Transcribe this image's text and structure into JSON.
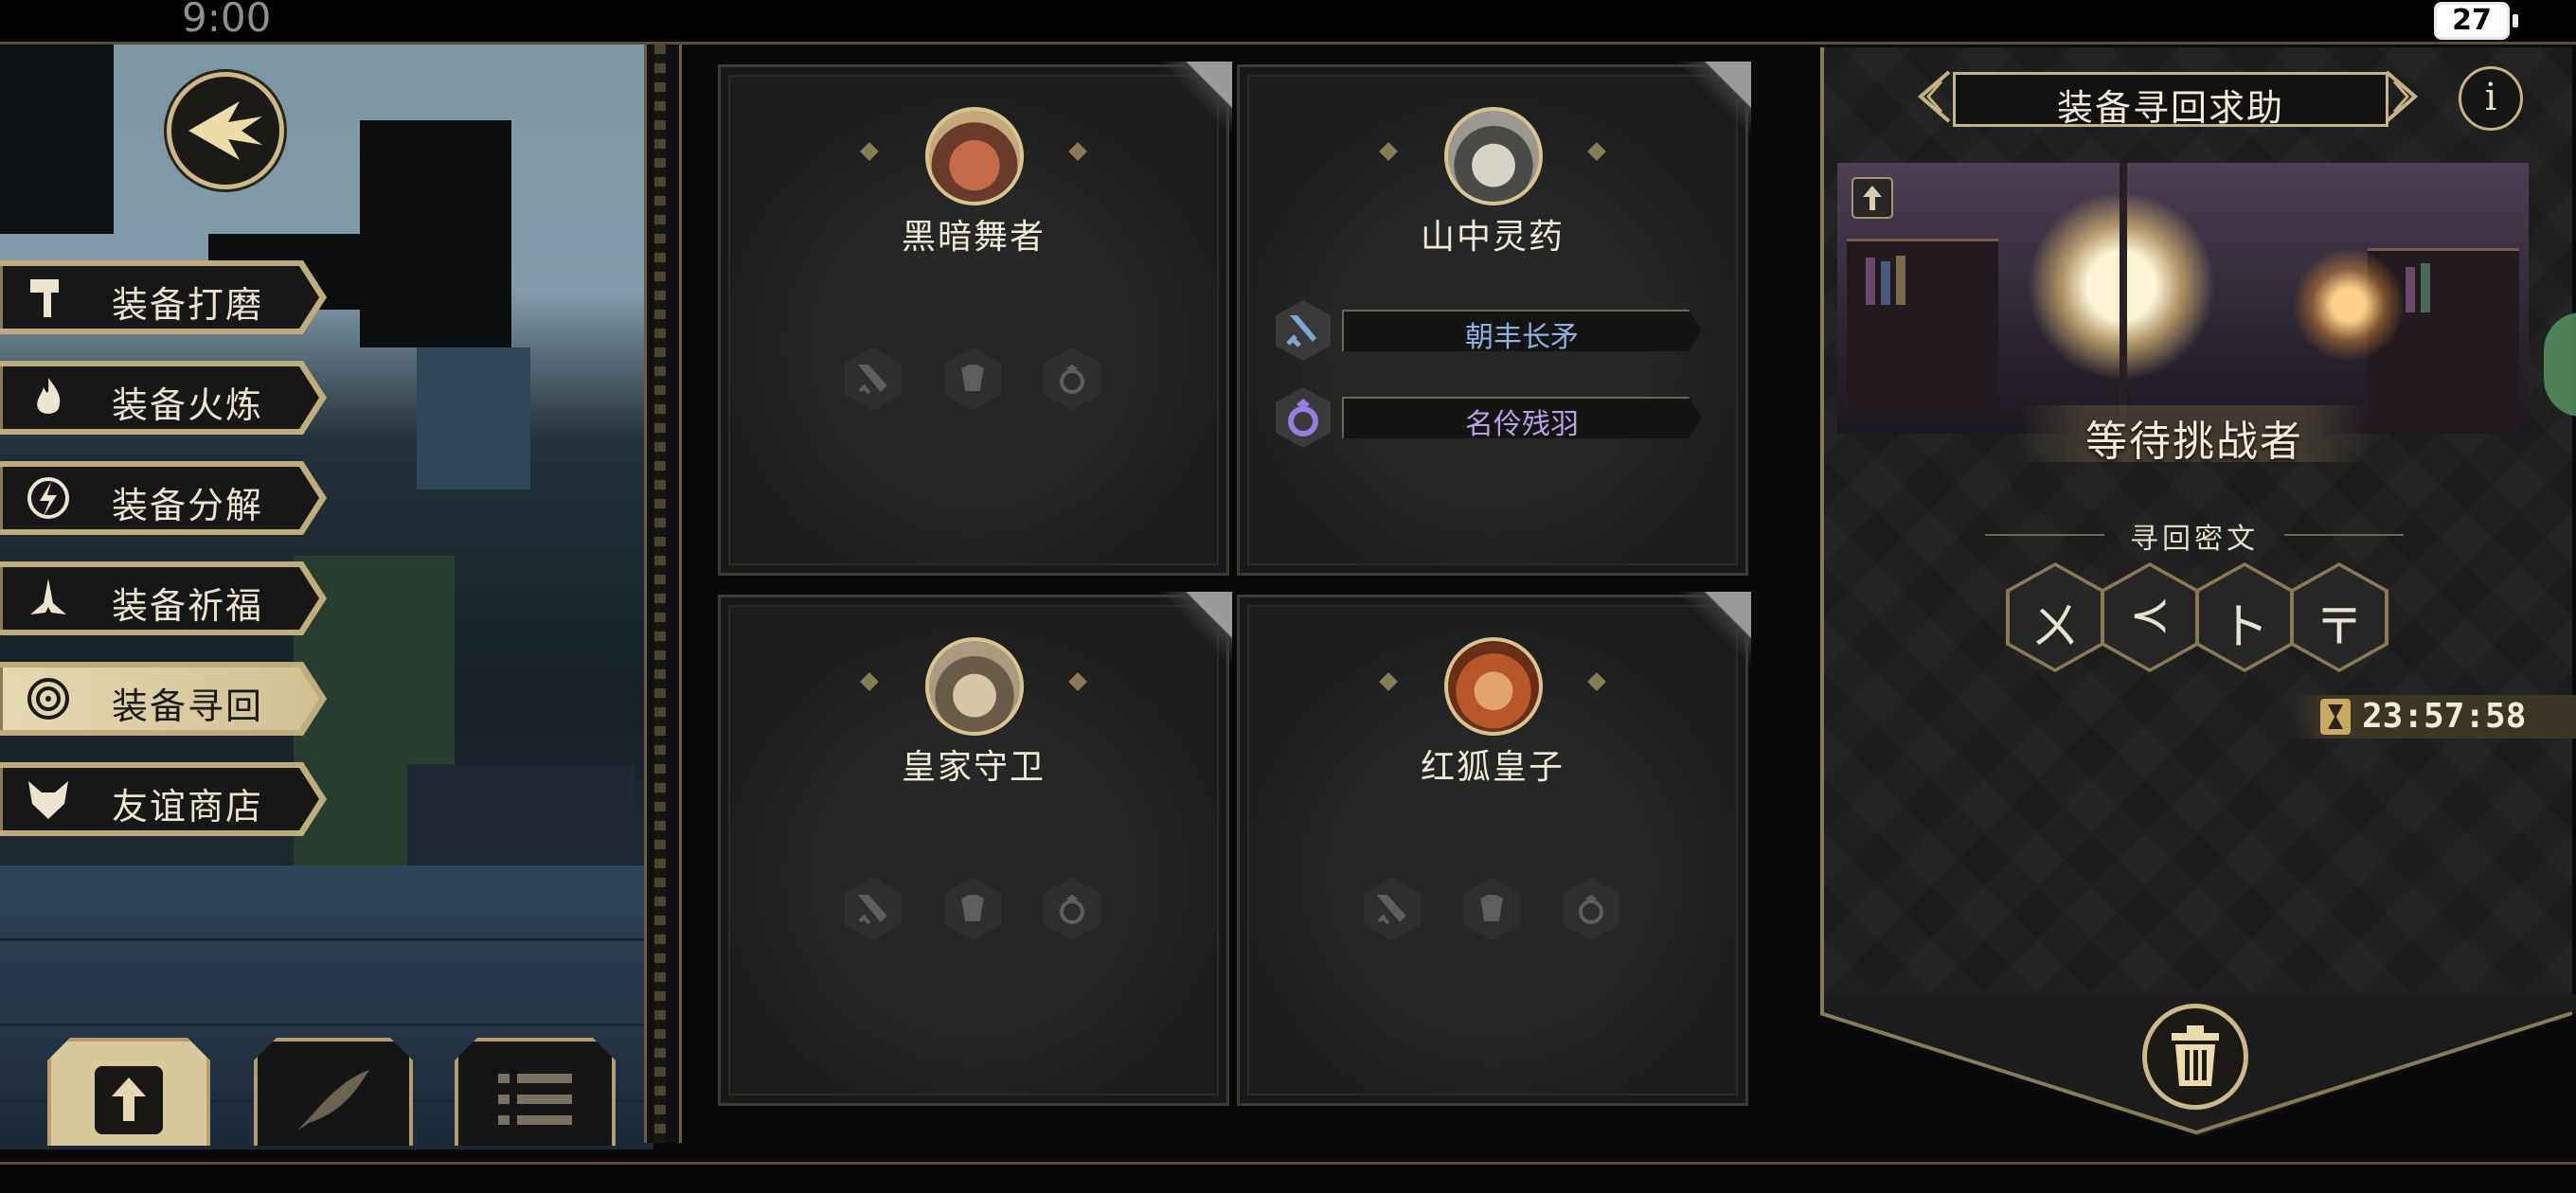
{
  "status_bar": {
    "time": "9:00",
    "battery": "27"
  },
  "menu": [
    {
      "label": "装备打磨",
      "icon": "hammer-icon",
      "active": false
    },
    {
      "label": "装备火炼",
      "icon": "flame-icon",
      "active": false
    },
    {
      "label": "装备分解",
      "icon": "lightning-icon",
      "active": false
    },
    {
      "label": "装备祈福",
      "icon": "praying-hands-icon",
      "active": false
    },
    {
      "label": "装备寻回",
      "icon": "target-icon",
      "active": true
    },
    {
      "label": "友谊商店",
      "icon": "fox-icon",
      "active": false
    }
  ],
  "cards": [
    {
      "name": "黑暗舞者",
      "avatar": "fox-dancer-portrait",
      "equipped": []
    },
    {
      "name": "山中灵药",
      "avatar": "frog-portrait",
      "equipped": [
        {
          "label": "朝丰长矛",
          "icon": "sword-icon",
          "color": "#8fb0e0"
        },
        {
          "label": "名伶残羽",
          "icon": "ring-icon",
          "color": "#b9a0e6"
        }
      ]
    },
    {
      "name": "皇家守卫",
      "avatar": "boar-guard-portrait",
      "equipped": []
    },
    {
      "name": "红狐皇子",
      "avatar": "red-fox-portrait",
      "equipped": []
    }
  ],
  "panel": {
    "title": "装备寻回求助",
    "info": "i",
    "status": "等待挑战者",
    "cipher_label": "寻回密文",
    "runes": [
      "ㄨ",
      "≺",
      "ト",
      "〒"
    ],
    "timer": "23:57:58"
  },
  "colors": {
    "gold": "#c6b282",
    "panel_bg": "#1c1c1c",
    "active_tab": "#e6d9b2"
  }
}
